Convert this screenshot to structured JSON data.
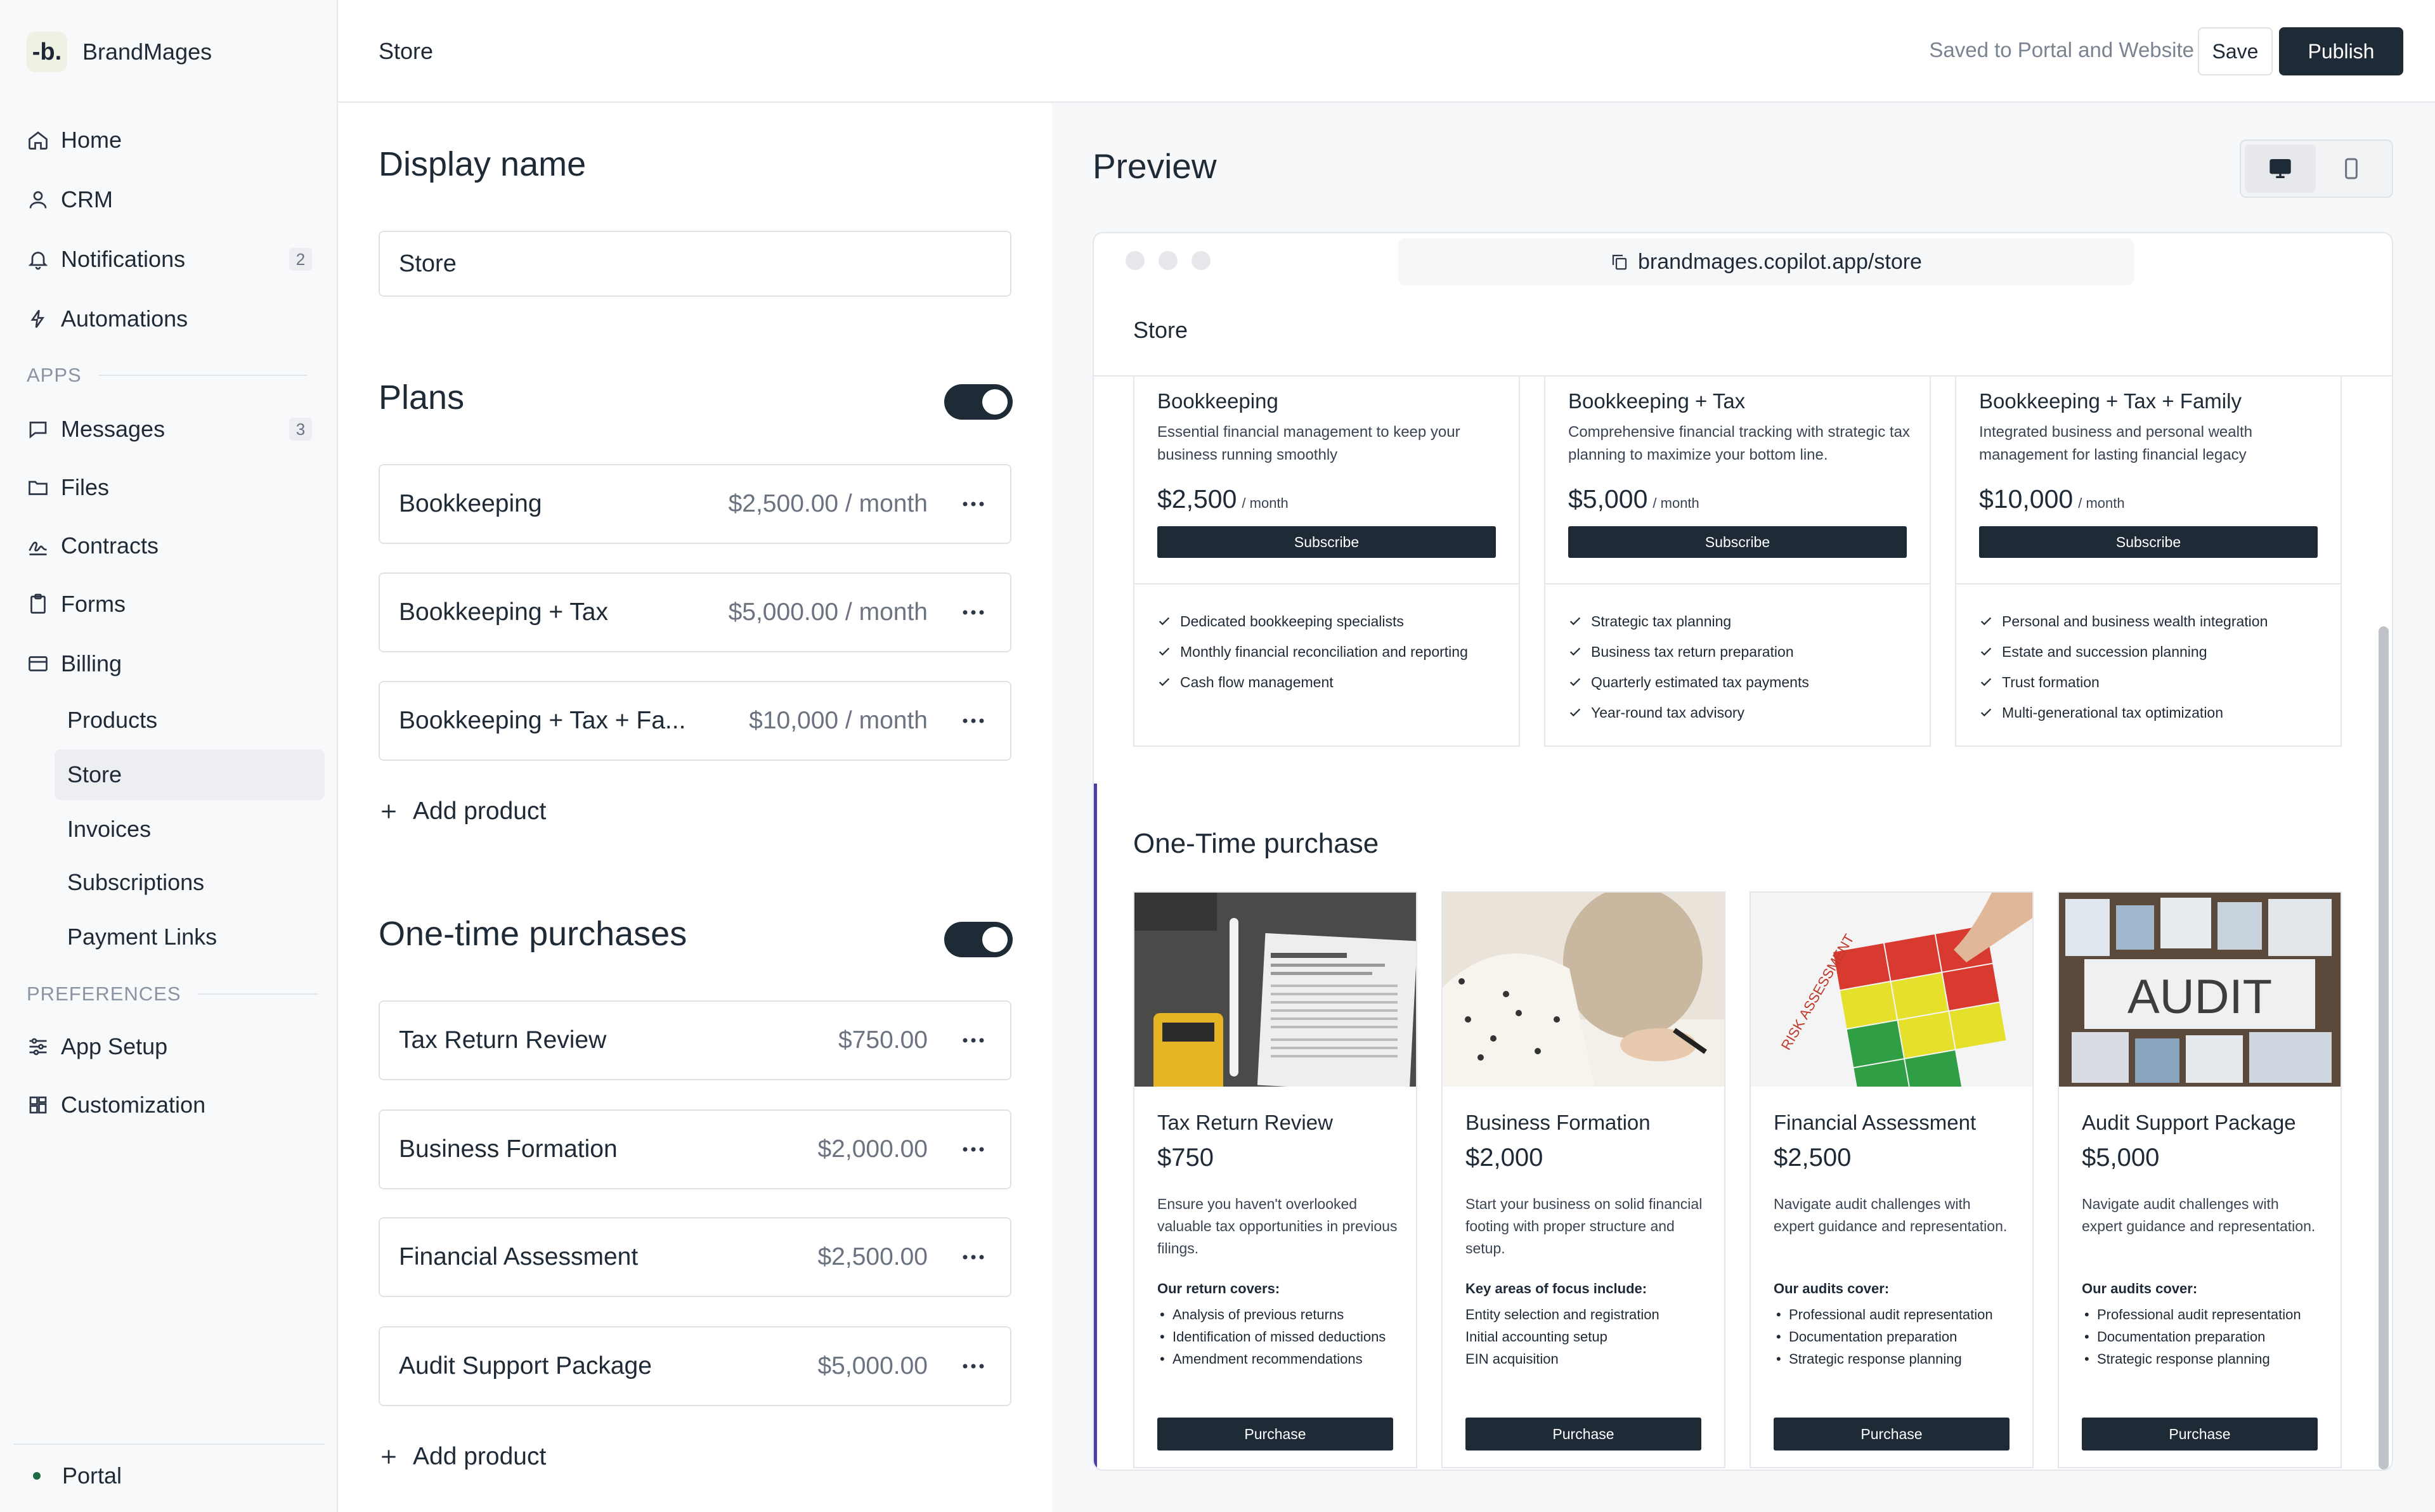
{
  "brand": {
    "logo_text": "-b.",
    "name": "BrandMages"
  },
  "sidebar": {
    "nav": [
      {
        "label": "Home",
        "icon": "home-icon"
      },
      {
        "label": "CRM",
        "icon": "user-icon"
      },
      {
        "label": "Notifications",
        "icon": "bell-icon",
        "badge": "2"
      },
      {
        "label": "Automations",
        "icon": "bolt-icon"
      }
    ],
    "apps_label": "APPS",
    "apps": [
      {
        "label": "Messages",
        "icon": "message-icon",
        "badge": "3"
      },
      {
        "label": "Files",
        "icon": "folder-icon"
      },
      {
        "label": "Contracts",
        "icon": "signature-icon"
      },
      {
        "label": "Forms",
        "icon": "clipboard-icon"
      },
      {
        "label": "Billing",
        "icon": "card-icon"
      }
    ],
    "billing_sub": [
      "Products",
      "Store",
      "Invoices",
      "Subscriptions",
      "Payment Links"
    ],
    "active_sub": "Store",
    "preferences_label": "PREFERENCES",
    "preferences": [
      {
        "label": "App Setup",
        "icon": "sliders-icon"
      },
      {
        "label": "Customization",
        "icon": "grid-icon"
      }
    ],
    "portal_label": "Portal"
  },
  "header": {
    "title": "Store",
    "saved_status": "Saved to Portal and Website",
    "save_label": "Save",
    "publish_label": "Publish"
  },
  "editor": {
    "display_name_heading": "Display name",
    "display_name_value": "Store",
    "plans_heading": "Plans",
    "plans_enabled": true,
    "plans": [
      {
        "name": "Bookkeeping",
        "price": "$2,500.00 / month"
      },
      {
        "name": "Bookkeeping + Tax",
        "price": "$5,000.00 / month"
      },
      {
        "name": "Bookkeeping + Tax + Fa...",
        "price": "$10,000 / month"
      }
    ],
    "add_product_label": "Add product",
    "one_time_heading": "One-time purchases",
    "one_time_enabled": true,
    "one_time": [
      {
        "name": "Tax Return Review",
        "price": "$750.00"
      },
      {
        "name": "Business Formation",
        "price": "$2,000.00"
      },
      {
        "name": "Financial Assessment",
        "price": "$2,500.00"
      },
      {
        "name": "Audit Support Package",
        "price": "$5,000.00"
      }
    ]
  },
  "preview": {
    "heading": "Preview",
    "device_mode": "desktop",
    "url": "brandmages.copilot.app/store",
    "site_title": "Store",
    "plan_cards": [
      {
        "name": "Bookkeeping",
        "desc": "Essential financial management to keep your business running smoothly",
        "price": "$2,500",
        "period": "/ month",
        "button": "Subscribe",
        "features": [
          "Dedicated bookkeeping specialists",
          "Monthly financial reconciliation and reporting",
          "Cash flow management"
        ]
      },
      {
        "name": "Bookkeeping + Tax",
        "desc": "Comprehensive financial tracking with strategic tax planning to maximize your bottom line.",
        "price": "$5,000",
        "period": "/ month",
        "button": "Subscribe",
        "features": [
          "Strategic tax planning",
          "Business tax return preparation",
          "Quarterly estimated tax payments",
          "Year-round tax advisory"
        ]
      },
      {
        "name": "Bookkeeping + Tax + Family",
        "desc": "Integrated business and personal wealth management for lasting financial legacy",
        "price": "$10,000",
        "period": "/ month",
        "button": "Subscribe",
        "features": [
          "Personal and business wealth integration",
          "Estate and succession planning",
          "Trust formation",
          "Multi-generational tax optimization"
        ]
      }
    ],
    "one_time_heading": "One-Time purchase",
    "one_time_cards": [
      {
        "name": "Tax Return Review",
        "price": "$750",
        "desc": "Ensure you haven't overlooked valuable tax opportunities in previous filings.",
        "list_heading": "Our return covers:",
        "list": [
          "Analysis of previous returns",
          "Identification of missed deductions",
          "Amendment recommendations"
        ],
        "bulleted": true,
        "button": "Purchase",
        "image_text": ""
      },
      {
        "name": "Business Formation",
        "price": "$2,000",
        "desc": "Start your business on solid financial footing with proper structure and setup.",
        "list_heading": "Key areas of focus include:",
        "list": [
          "Entity selection and registration",
          "Initial accounting setup",
          "EIN acquisition"
        ],
        "bulleted": false,
        "button": "Purchase",
        "image_text": ""
      },
      {
        "name": "Financial Assessment",
        "price": "$2,500",
        "desc": "Navigate audit challenges with expert guidance and representation.",
        "list_heading": "Our audits cover:",
        "list": [
          "Professional audit representation",
          "Documentation preparation",
          "Strategic response planning"
        ],
        "bulleted": true,
        "button": "Purchase",
        "image_text": "RISK ASSESSMENT"
      },
      {
        "name": "Audit Support Package",
        "price": "$5,000",
        "desc": "Navigate audit challenges with expert guidance and representation.",
        "list_heading": "Our audits cover:",
        "list": [
          "Professional audit representation",
          "Documentation preparation",
          "Strategic response planning"
        ],
        "bulleted": true,
        "button": "Purchase",
        "image_text": "AUDIT"
      }
    ]
  },
  "colors": {
    "primary": "#1f2a37",
    "accent": "#4a3ea8",
    "status_online": "#1d6b43"
  }
}
